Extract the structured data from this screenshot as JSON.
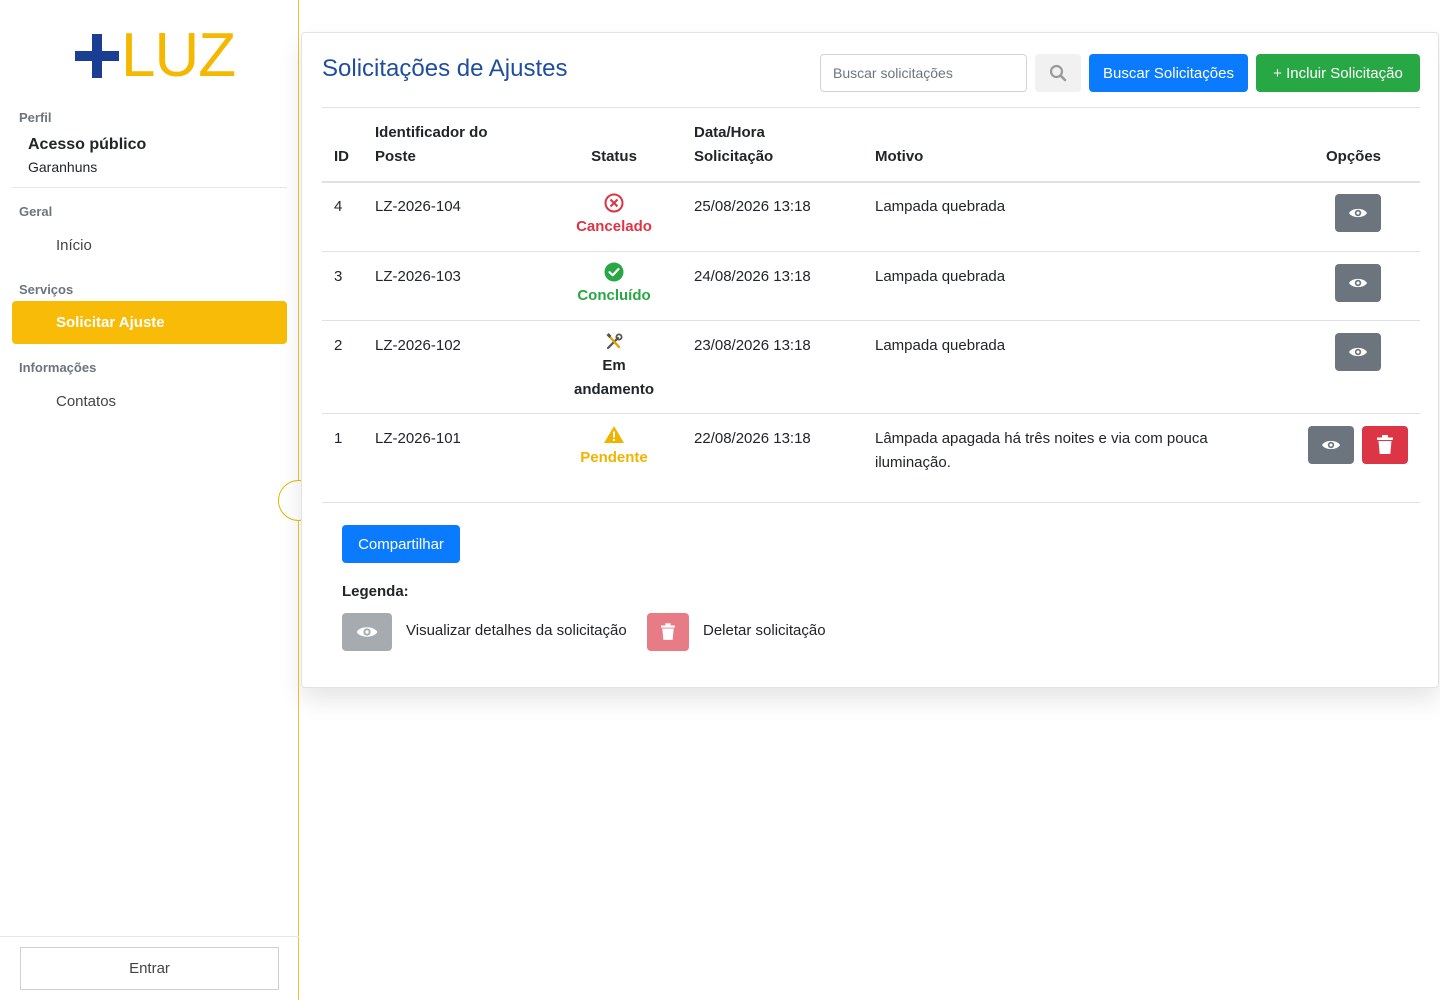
{
  "sidebar": {
    "logo_text": "LUZ",
    "profile_label": "Perfil",
    "profile_name": "Acesso público",
    "profile_city": "Garanhuns",
    "geral_label": "Geral",
    "inicio": "Início",
    "servicos_label": "Serviços",
    "solicitar_ajuste": "Solicitar Ajuste",
    "informacoes_label": "Informações",
    "contatos": "Contatos",
    "login_button": "Entrar"
  },
  "main": {
    "title": "Solicitações de Ajustes",
    "search_placeholder": "Buscar solicitações",
    "search_button": "Buscar Solicitações",
    "add_button": "+ Incluir Solicitação",
    "table": {
      "headers": {
        "id": "ID",
        "poste_line1": "Identificador do",
        "poste_line2": "Poste",
        "status": "Status",
        "data_line1": "Data/Hora",
        "data_line2": "Solicitação",
        "motivo": "Motivo",
        "opcoes": "Opções"
      },
      "rows": [
        {
          "id": "4",
          "poste": "LZ-2026-104",
          "status": "Cancelado",
          "status_color": "#dc3545",
          "status_icon": "x-circle-icon",
          "data": "25/08/2026 13:18",
          "motivo": "Lampada quebrada"
        },
        {
          "id": "3",
          "poste": "LZ-2026-103",
          "status": "Concluído",
          "status_color": "#28a745",
          "status_icon": "check-circle-icon",
          "data": "24/08/2026 13:18",
          "motivo": "Lampada quebrada"
        },
        {
          "id": "2",
          "poste": "LZ-2026-102",
          "status_line1": "Em",
          "status_line2": "andamento",
          "status_color": "#212529",
          "status_icon": "tools-icon",
          "data": "23/08/2026 13:18",
          "motivo": "Lampada quebrada"
        },
        {
          "id": "1",
          "poste": "LZ-2026-101",
          "status": "Pendente",
          "status_color": "#f0b400",
          "status_icon": "warning-icon",
          "data": "22/08/2026 13:18",
          "motivo_line1": "Lâmpada apagada há três noites e via com pouca",
          "motivo_line2": "iluminação."
        }
      ]
    },
    "share_button": "Compartilhar",
    "legend": {
      "title": "Legenda:",
      "view_text": "Visualizar detalhes da solicitação",
      "delete_text": "Deletar solicitação"
    }
  },
  "colors": {
    "primary_blue": "#0a7bff",
    "green": "#28a745",
    "yellow": "#f7bb08",
    "title_blue": "#1f4e9f",
    "logo_blue": "#1a3e92"
  }
}
